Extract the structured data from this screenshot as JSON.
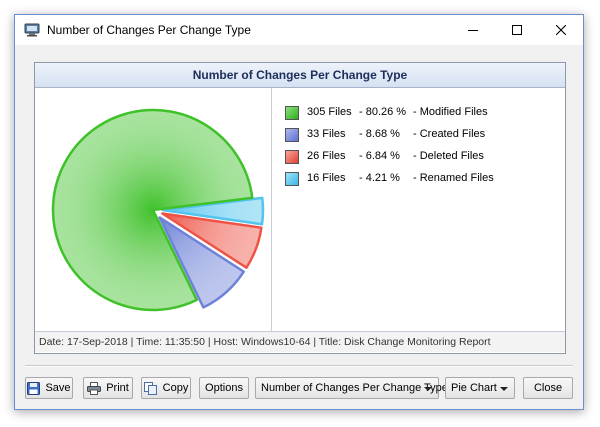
{
  "window": {
    "title": "Number of Changes Per Change Type"
  },
  "chart_data": {
    "type": "pie",
    "title": "Number of Changes Per Change Type",
    "categories": [
      "Modified Files",
      "Created Files",
      "Deleted Files",
      "Renamed Files"
    ],
    "values": [
      305,
      33,
      26,
      16
    ],
    "percentages": [
      80.26,
      8.68,
      6.84,
      4.21
    ],
    "exploded": [
      false,
      true,
      true,
      true
    ],
    "colors": [
      "#3fc12a",
      "#6e82d8",
      "#ee5446",
      "#52c4ee"
    ],
    "legend_placement": "right",
    "legend": [
      {
        "files": "305 Files",
        "percent": "- 80.26 %",
        "name": "- Modified Files"
      },
      {
        "files": "33 Files",
        "percent": "- 8.68 %",
        "name": "- Created Files"
      },
      {
        "files": "26 Files",
        "percent": "- 6.84 %",
        "name": "- Deleted Files"
      },
      {
        "files": "16 Files",
        "percent": "- 4.21 %",
        "name": "- Renamed Files"
      }
    ]
  },
  "footer": {
    "info": "Date: 17-Sep-2018 | Time: 11:35:50 | Host: Windows10-64 | Title: Disk Change Monitoring Report"
  },
  "buttons": {
    "save": "Save",
    "print": "Print",
    "copy": "Copy",
    "options": "Options",
    "close": "Close"
  },
  "dropdowns": {
    "chart_source": "Number of Changes Per Change Type",
    "chart_type": "Pie Chart"
  },
  "icons": {
    "app": "monitor-icon",
    "save": "floppy-disk-icon",
    "print": "printer-icon",
    "copy": "copy-icon"
  }
}
